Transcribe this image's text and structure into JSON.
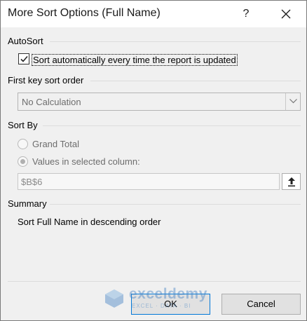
{
  "dialog": {
    "title": "More Sort Options (Full Name)",
    "help_label": "?"
  },
  "autosort": {
    "heading": "AutoSort",
    "checkbox_label": "Sort automatically every time the report is updated",
    "checked": true
  },
  "first_key": {
    "heading": "First key sort order",
    "selected": "No Calculation"
  },
  "sort_by": {
    "heading": "Sort By",
    "option_grand_total": "Grand Total",
    "option_values": "Values in selected column:",
    "reference_value": "$B$6"
  },
  "summary": {
    "heading": "Summary",
    "text": "Sort Full Name in descending order"
  },
  "buttons": {
    "ok": "OK",
    "cancel": "Cancel"
  },
  "watermark": {
    "name": "exceldemy",
    "tagline": "EXCEL · DATA · BI"
  },
  "colors": {
    "dialog_bg": "#f0f0f0",
    "titlebar_bg": "#ffffff",
    "disabled_text": "#6d6d6d",
    "ok_border": "#0078d7",
    "watermark": "#4a86c5"
  }
}
